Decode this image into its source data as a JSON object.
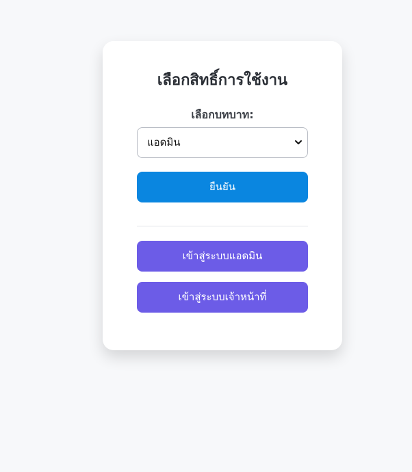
{
  "card": {
    "title": "เลือกสิทธิ์การใช้งาน",
    "role_label": "เลือกบทบาท:",
    "role_select": {
      "selected": "แอดมิน"
    },
    "confirm_button": "ยืนยัน",
    "admin_login_button": "เข้าสู่ระบบแอดมิน",
    "staff_login_button": "เข้าสู่ระบบเจ้าหน้าที่"
  },
  "colors": {
    "confirm": "#0a86e0",
    "login_buttons": "#6c5ce7",
    "background": "#f7f8fa"
  },
  "icons": {
    "select_arrow": "chevron-down-icon"
  }
}
